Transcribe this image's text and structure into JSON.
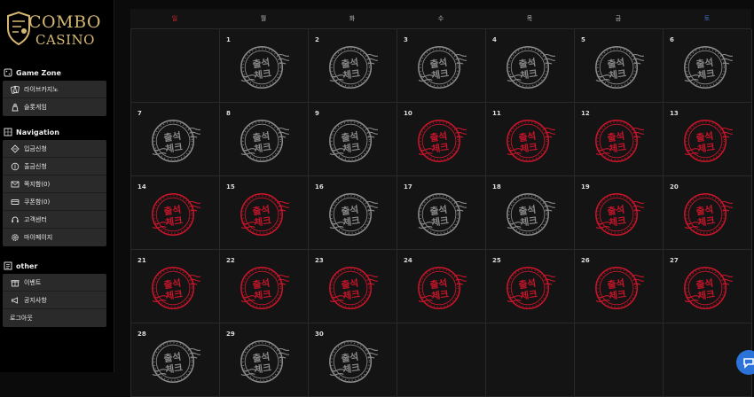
{
  "brand": {
    "line1": "COMBO",
    "line2": "CASINO"
  },
  "sidebar": {
    "sections": [
      {
        "title": "Game Zone",
        "icon": "dice-icon",
        "items": [
          {
            "label": "라이브카지노",
            "icon": "cards-icon"
          },
          {
            "label": "슬롯게임",
            "icon": "slot-icon"
          }
        ]
      },
      {
        "title": "Navigation",
        "icon": "grid-icon",
        "items": [
          {
            "label": "입금신청",
            "icon": "deposit-icon"
          },
          {
            "label": "출금신청",
            "icon": "withdraw-icon"
          },
          {
            "label": "쪽지함(0)",
            "icon": "mail-icon"
          },
          {
            "label": "쿠폰함(0)",
            "icon": "coupon-icon"
          },
          {
            "label": "고객센터",
            "icon": "headset-icon"
          },
          {
            "label": "마이페이지",
            "icon": "gear-icon"
          }
        ]
      },
      {
        "title": "other",
        "icon": "list-icon",
        "items": [
          {
            "label": "이벤트",
            "icon": "gift-icon"
          },
          {
            "label": "공지사항",
            "icon": "megaphone-icon"
          },
          {
            "label": "로그아웃",
            "icon": ""
          }
        ]
      }
    ]
  },
  "calendar": {
    "weekdays": [
      "일",
      "월",
      "화",
      "수",
      "목",
      "금",
      "토"
    ],
    "stamp_text": [
      "출석",
      "체크"
    ],
    "colors": {
      "gray": "#8a8a8a",
      "red": "#c8152a"
    },
    "days": [
      null,
      {
        "day": "1",
        "stamp": "gray"
      },
      {
        "day": "2",
        "stamp": "gray"
      },
      {
        "day": "3",
        "stamp": "gray"
      },
      {
        "day": "4",
        "stamp": "gray"
      },
      {
        "day": "5",
        "stamp": "gray"
      },
      {
        "day": "6",
        "stamp": "gray"
      },
      {
        "day": "7",
        "stamp": "gray"
      },
      {
        "day": "8",
        "stamp": "gray"
      },
      {
        "day": "9",
        "stamp": "gray"
      },
      {
        "day": "10",
        "stamp": "red"
      },
      {
        "day": "11",
        "stamp": "red"
      },
      {
        "day": "12",
        "stamp": "red"
      },
      {
        "day": "13",
        "stamp": "red"
      },
      {
        "day": "14",
        "stamp": "red"
      },
      {
        "day": "15",
        "stamp": "red"
      },
      {
        "day": "16",
        "stamp": "gray"
      },
      {
        "day": "17",
        "stamp": "gray"
      },
      {
        "day": "18",
        "stamp": "gray"
      },
      {
        "day": "19",
        "stamp": "red"
      },
      {
        "day": "20",
        "stamp": "red"
      },
      {
        "day": "21",
        "stamp": "red"
      },
      {
        "day": "22",
        "stamp": "red"
      },
      {
        "day": "23",
        "stamp": "red"
      },
      {
        "day": "24",
        "stamp": "red"
      },
      {
        "day": "25",
        "stamp": "red"
      },
      {
        "day": "26",
        "stamp": "red"
      },
      {
        "day": "27",
        "stamp": "red"
      },
      {
        "day": "28",
        "stamp": "gray"
      },
      {
        "day": "29",
        "stamp": "gray"
      },
      {
        "day": "30",
        "stamp": "gray"
      },
      null,
      null,
      null,
      null
    ]
  }
}
